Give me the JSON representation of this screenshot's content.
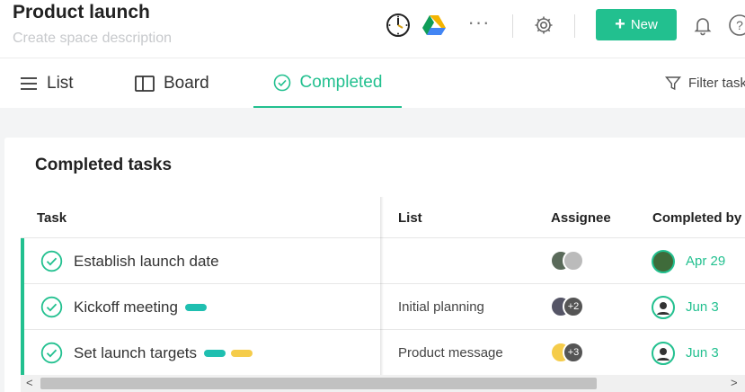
{
  "header": {
    "title": "Product launch",
    "description_placeholder": "Create space description",
    "icons": [
      "clock-icon",
      "google-drive-icon",
      "more-icon",
      "gear-icon",
      "bell-icon",
      "help-icon"
    ],
    "more_label": "···",
    "new_button_label": "New",
    "help_label": "?"
  },
  "tabs": [
    {
      "label": "List",
      "icon": "list-icon"
    },
    {
      "label": "Board",
      "icon": "board-icon"
    },
    {
      "label": "Completed",
      "icon": "check-circle-icon",
      "active": true
    }
  ],
  "filter": {
    "label": "Filter tasks",
    "icon": "filter-icon"
  },
  "colors": {
    "accent": "#22c08f",
    "teal_tag": "#1fbfb0",
    "yellow_tag": "#f5cc4a"
  },
  "panel": {
    "title": "Completed tasks",
    "columns": [
      "Task",
      "List",
      "Assignee",
      "Completed by"
    ],
    "rows": [
      {
        "task": "Establish launch date",
        "list": "",
        "assignees": [],
        "extra": "",
        "date": "Apr 29",
        "tags": []
      },
      {
        "task": "Kickoff meeting",
        "list": "Initial planning",
        "extra": "+2",
        "date": "Jun 3",
        "tags": [
          "#1fbfb0"
        ]
      },
      {
        "task": "Set launch targets",
        "list": "Product message",
        "extra": "+3",
        "date": "Jun 3",
        "tags": [
          "#1fbfb0",
          "#f5cc4a"
        ]
      }
    ]
  },
  "scrollbar": {
    "left_arrow": "<",
    "right_arrow": ">"
  }
}
